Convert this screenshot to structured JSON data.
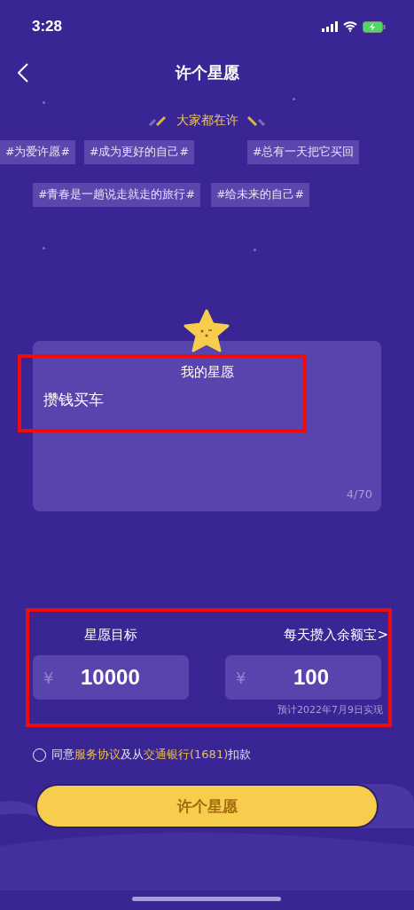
{
  "status_bar": {
    "time": "3:28"
  },
  "nav": {
    "title": "许个星愿"
  },
  "section_title": "大家都在许",
  "tag_rows": [
    [
      "#为爱许愿#",
      "#成为更好的自己#",
      "#总有一天把它买回"
    ],
    [
      "#青春是一趟说走就走的旅行#",
      "#给未来的自己#"
    ]
  ],
  "wish_card": {
    "title": "我的星愿",
    "value": "攒钱买车",
    "counter": "4/70"
  },
  "goal": {
    "label": "星愿目标",
    "currency": "¥",
    "value": "10000"
  },
  "daily": {
    "label": "每天攒入余额宝",
    "chevron": ">",
    "currency": "¥",
    "value": "100",
    "estimate": "预计2022年7月9日实现"
  },
  "agreement": {
    "checked": false,
    "parts": [
      {
        "kind": "text",
        "text": "同意"
      },
      {
        "kind": "link",
        "text": "服务协议"
      },
      {
        "kind": "text",
        "text": "及从"
      },
      {
        "kind": "link",
        "text": "交通银行(1681)"
      },
      {
        "kind": "text",
        "text": "扣款"
      }
    ]
  },
  "submit_button": "许个星愿"
}
